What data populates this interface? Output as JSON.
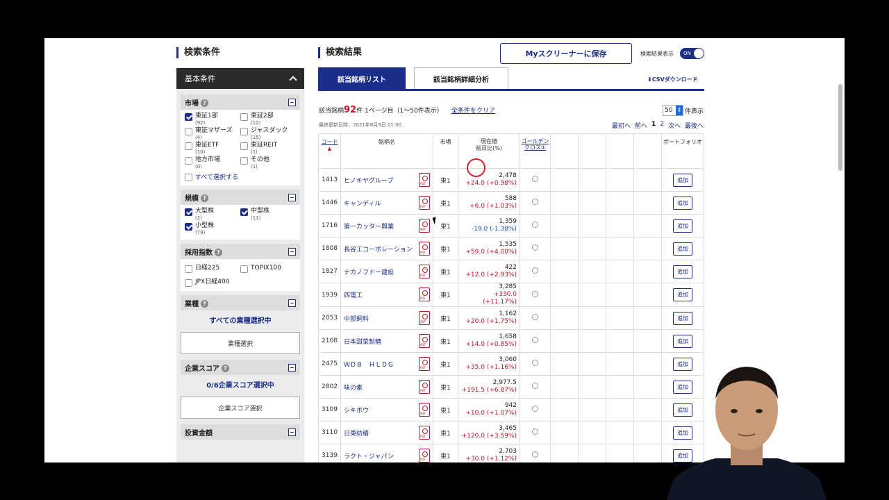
{
  "sidebar": {
    "title": "検索条件",
    "panel_title": "基本条件",
    "market": {
      "title": "市場",
      "items": [
        {
          "label": "東証1部",
          "count": "(92)",
          "checked": true
        },
        {
          "label": "東証2部",
          "count": "(12)",
          "checked": false
        },
        {
          "label": "東証マザーズ",
          "count": "(4)",
          "checked": false
        },
        {
          "label": "ジャスダック",
          "count": "(15)",
          "checked": false
        },
        {
          "label": "東証ETF",
          "count": "(10)",
          "checked": false
        },
        {
          "label": "東証REIT",
          "count": "(1)",
          "checked": false
        },
        {
          "label": "地方市場",
          "count": "(0)",
          "checked": false
        },
        {
          "label": "その他",
          "count": "(1)",
          "checked": false
        }
      ],
      "select_all": "すべて選択する"
    },
    "scale": {
      "title": "規模",
      "items": [
        {
          "label": "大型株",
          "count": "(2)",
          "checked": true
        },
        {
          "label": "中型株",
          "count": "(11)",
          "checked": true
        },
        {
          "label": "小型株",
          "count": "(79)",
          "checked": true
        }
      ]
    },
    "index": {
      "title": "採用指数",
      "items": [
        {
          "label": "日経225",
          "checked": false
        },
        {
          "label": "TOPIX100",
          "checked": false
        },
        {
          "label": "JPX日経400",
          "checked": false
        }
      ]
    },
    "industry": {
      "title": "業種",
      "selected_text": "すべての業種選択中",
      "button": "業種選択"
    },
    "score": {
      "title": "企業スコア",
      "selected_text": "0/6企業スコア選択中",
      "button": "企業スコア選択"
    },
    "investment": {
      "title": "投資金額"
    }
  },
  "main": {
    "title": "検索結果",
    "save_button": "Myスクリーナーに保存",
    "toggle_label": "検索結果表示",
    "toggle_state": "ON",
    "tabs": [
      "該当銘柄リスト",
      "該当銘柄詳細分析"
    ],
    "csv": "CSVダウンロード",
    "info_prefix": "該当銘柄",
    "count": "92",
    "info_suffix": "件 1ページ目（1〜50件表示）",
    "clear": "全条件をクリア",
    "per_page_value": "50",
    "per_page_suffix": "件表示",
    "updated": "最終更新日時：2021年8月3日 01:00",
    "pager": {
      "first": "最初へ",
      "prev": "前へ",
      "p1": "1",
      "p2": "2",
      "next": "次へ",
      "last": "最後へ"
    }
  },
  "table": {
    "headers": {
      "code": "コード",
      "name": "銘柄名",
      "market": "市場",
      "price_1": "現在値",
      "price_2": "前日比(%)",
      "gc": "ゴールデンクロス①",
      "portfolio": "ポートフォリオ"
    },
    "add_label": "追加",
    "rows": [
      {
        "code": "1413",
        "name": "ヒノキヤグループ",
        "market": "東1",
        "price": "2,478",
        "change": "+24.0 (+0.98%)",
        "dir": "up"
      },
      {
        "code": "1446",
        "name": "キャンディル",
        "market": "東1",
        "price": "588",
        "change": "+6.0 (+1.03%)",
        "dir": "up"
      },
      {
        "code": "1716",
        "name": "第一カッター興業",
        "market": "東1",
        "price": "1,359",
        "change": "-19.0 (-1.38%)",
        "dir": "down"
      },
      {
        "code": "1808",
        "name": "長谷工コーポレーション",
        "market": "東1",
        "price": "1,535",
        "change": "+59.0 (+4.00%)",
        "dir": "up"
      },
      {
        "code": "1827",
        "name": "ナカノフドー建設",
        "market": "東1",
        "price": "422",
        "change": "+12.0 (+2.93%)",
        "dir": "up"
      },
      {
        "code": "1939",
        "name": "四電工",
        "market": "東1",
        "price": "3,285",
        "change": "+330.0 (+11.17%)",
        "dir": "up"
      },
      {
        "code": "2053",
        "name": "中部飼料",
        "market": "東1",
        "price": "1,162",
        "change": "+20.0 (+1.75%)",
        "dir": "up"
      },
      {
        "code": "2108",
        "name": "日本甜菜製糖",
        "market": "東1",
        "price": "1,658",
        "change": "+14.0 (+0.85%)",
        "dir": "up"
      },
      {
        "code": "2475",
        "name": "ＷＤＢ　ＨＬＤＧ",
        "market": "東1",
        "price": "3,060",
        "change": "+35.0 (+1.16%)",
        "dir": "up"
      },
      {
        "code": "2802",
        "name": "味の素",
        "market": "東1",
        "price": "2,977.5",
        "change": "+191.5 (+6.87%)",
        "dir": "up"
      },
      {
        "code": "3109",
        "name": "シキボウ",
        "market": "東1",
        "price": "942",
        "change": "+10.0 (+1.07%)",
        "dir": "up"
      },
      {
        "code": "3110",
        "name": "日東紡績",
        "market": "東1",
        "price": "3,465",
        "change": "+120.0 (+3.59%)",
        "dir": "up"
      },
      {
        "code": "3139",
        "name": "ラクト・ジャパン",
        "market": "東1",
        "price": "2,703",
        "change": "+30.0 (+1.12%)",
        "dir": "up"
      }
    ]
  }
}
